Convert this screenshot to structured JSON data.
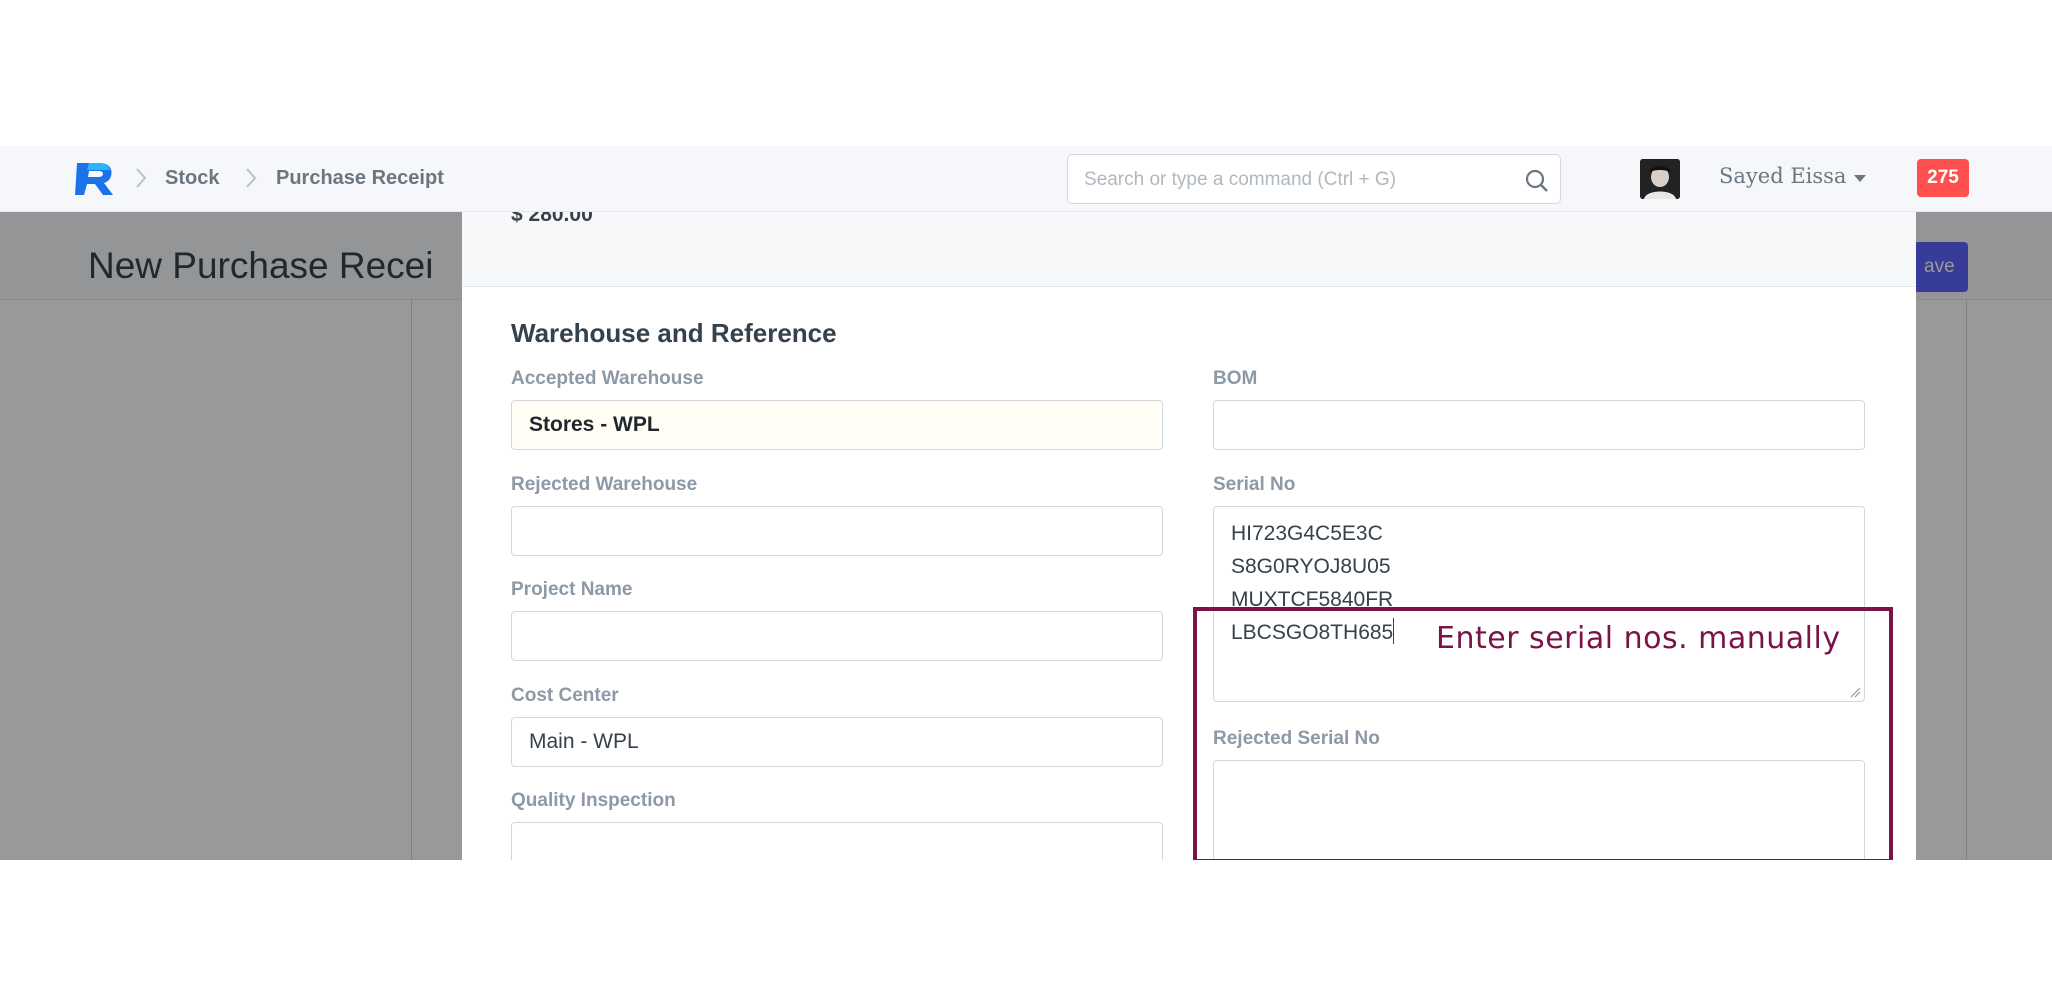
{
  "navbar": {
    "breadcrumbs": [
      "Stock",
      "Purchase Receipt"
    ],
    "search_placeholder": "Search or type a command (Ctrl + G)",
    "user_name": "Sayed Eissa",
    "notification_count": "275"
  },
  "page": {
    "title": "New Purchase Recei",
    "save_label": "ave"
  },
  "modal": {
    "amount": "$ 280.00",
    "section_title": "Warehouse and Reference",
    "fields": {
      "accepted_warehouse": {
        "label": "Accepted Warehouse",
        "value": "Stores - WPL"
      },
      "rejected_warehouse": {
        "label": "Rejected Warehouse",
        "value": ""
      },
      "project_name": {
        "label": "Project Name",
        "value": ""
      },
      "cost_center": {
        "label": "Cost Center",
        "value": "Main - WPL"
      },
      "quality_inspection": {
        "label": "Quality Inspection",
        "value": ""
      },
      "bom": {
        "label": "BOM",
        "value": ""
      },
      "serial_no": {
        "label": "Serial No",
        "values": [
          "HI723G4C5E3C",
          "S8G0RYOJ8U05",
          "MUXTCF5840FR",
          "LBCSGO8TH685"
        ]
      },
      "rejected_serial_no": {
        "label": "Rejected Serial No",
        "value": ""
      }
    }
  },
  "annotation": {
    "text": "Enter serial nos. manually",
    "color": "#7b1446"
  },
  "colors": {
    "accent": "#5e64ff",
    "notification": "#ff4f4f",
    "logo_blue": "#1a73e8"
  }
}
